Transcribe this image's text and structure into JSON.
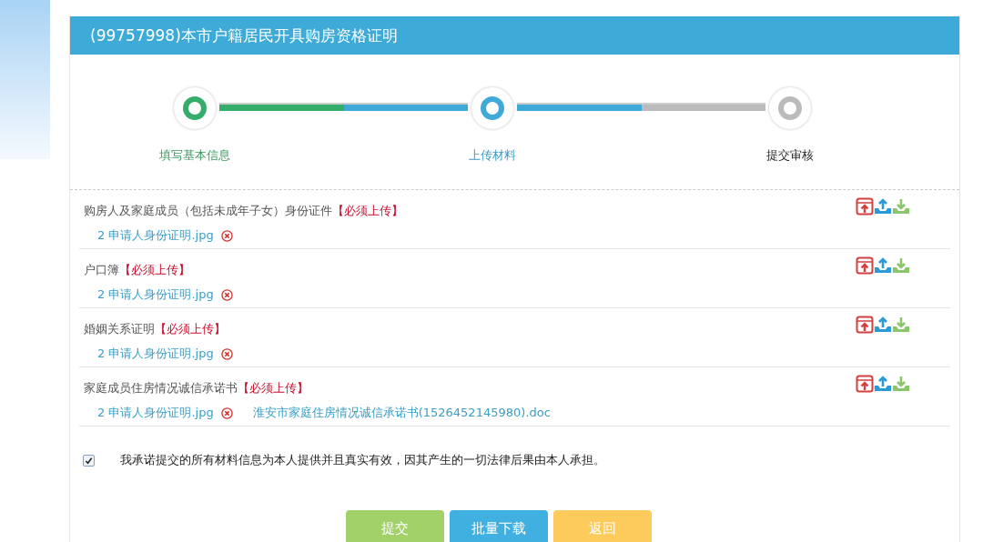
{
  "panel": {
    "title": "(99757998)本市户籍居民开具购房资格证明"
  },
  "steps": [
    {
      "label": "填写基本信息",
      "kind": "done"
    },
    {
      "label": "上传材料",
      "kind": "current"
    },
    {
      "label": "提交审核",
      "kind": "pending"
    }
  ],
  "materials": [
    {
      "name": "购房人及家庭成员（包括未成年子女）身份证件",
      "required": "【必须上传】",
      "files": [
        {
          "name": "2 申请人身份证明.jpg",
          "deletable": true
        }
      ]
    },
    {
      "name": "户口簿",
      "required": "【必须上传】",
      "files": [
        {
          "name": "2 申请人身份证明.jpg",
          "deletable": true
        }
      ]
    },
    {
      "name": "婚姻关系证明",
      "required": "【必须上传】",
      "files": [
        {
          "name": "2 申请人身份证明.jpg",
          "deletable": true
        }
      ]
    },
    {
      "name": "家庭成员住房情况诚信承诺书",
      "required": "【必须上传】",
      "files": [
        {
          "name": "2 申请人身份证明.jpg",
          "deletable": true
        },
        {
          "name": "淮安市家庭住房情况诚信承诺书(1526452145980).doc",
          "deletable": false
        }
      ]
    }
  ],
  "pledge": {
    "checked": true,
    "text": "我承诺提交的所有材料信息为本人提供并且真实有效，因其产生的一切法律后果由本人承担。"
  },
  "buttons": [
    {
      "label": "提交",
      "kind": "submit"
    },
    {
      "label": "批量下载",
      "kind": "download"
    },
    {
      "label": "返回",
      "kind": "back"
    }
  ]
}
